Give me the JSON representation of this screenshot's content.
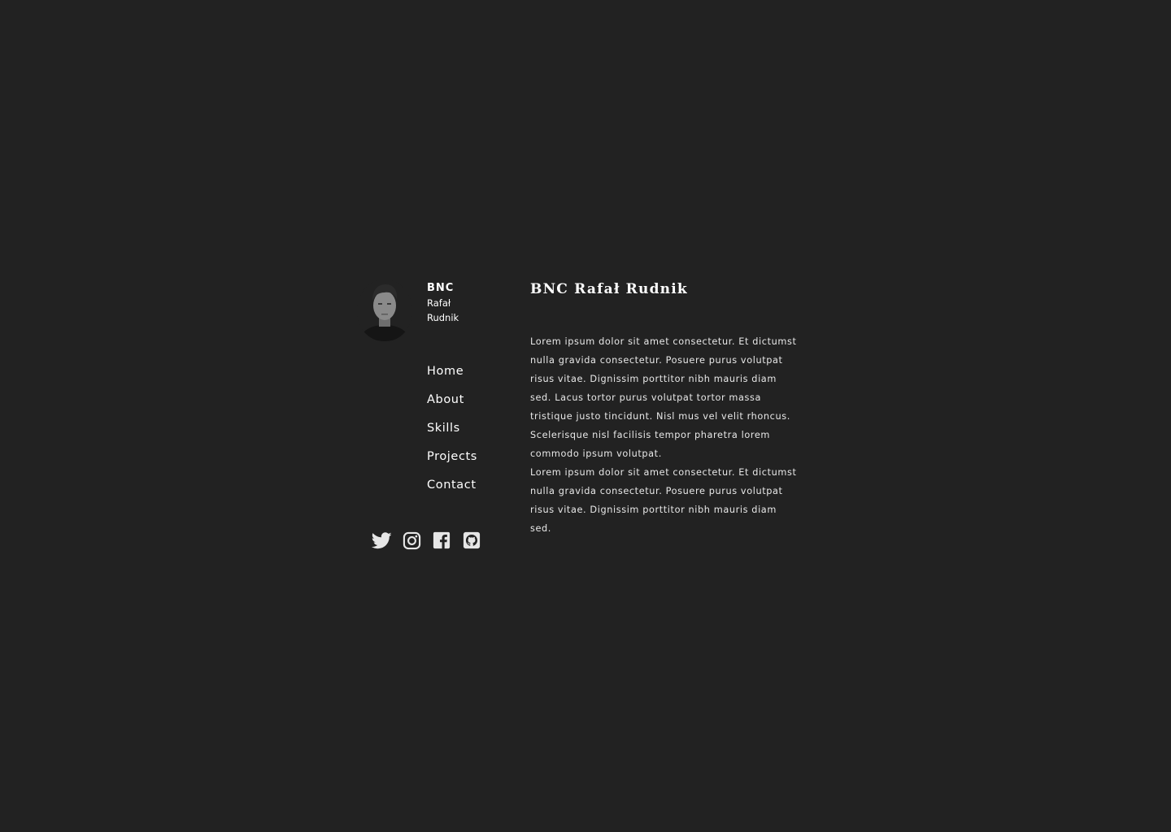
{
  "brand": {
    "short": "BNC",
    "first_name": "Rafał",
    "last_name": "Rudnik",
    "avatar_icon": "portrait-photo-grayscale"
  },
  "nav": {
    "items": [
      {
        "label": "Home"
      },
      {
        "label": "About"
      },
      {
        "label": "Skills"
      },
      {
        "label": "Projects"
      },
      {
        "label": "Contact"
      }
    ]
  },
  "social": {
    "icons": [
      "twitter-icon",
      "instagram-icon",
      "facebook-icon",
      "github-icon"
    ]
  },
  "main": {
    "title": "BNC Rafał Rudnik",
    "paragraphs": [
      "Lorem ipsum dolor sit amet consectetur. Et dictumst nulla gravida consectetur. Posuere purus volutpat risus vitae. Dignissim porttitor nibh mauris diam sed. Lacus tortor purus volutpat tortor massa tristique justo tincidunt. Nisl mus vel velit rhoncus. Scelerisque nisl facilisis tempor pharetra lorem commodo ipsum volutpat.",
      "Lorem ipsum dolor sit amet consectetur. Et dictumst nulla gravida consectetur. Posuere purus volutpat risus vitae. Dignissim porttitor nibh mauris diam sed."
    ]
  },
  "colors": {
    "background": "#222222",
    "text": "#ffffff",
    "body_text": "#e8e8e8",
    "icon": "#e6e6e6"
  }
}
